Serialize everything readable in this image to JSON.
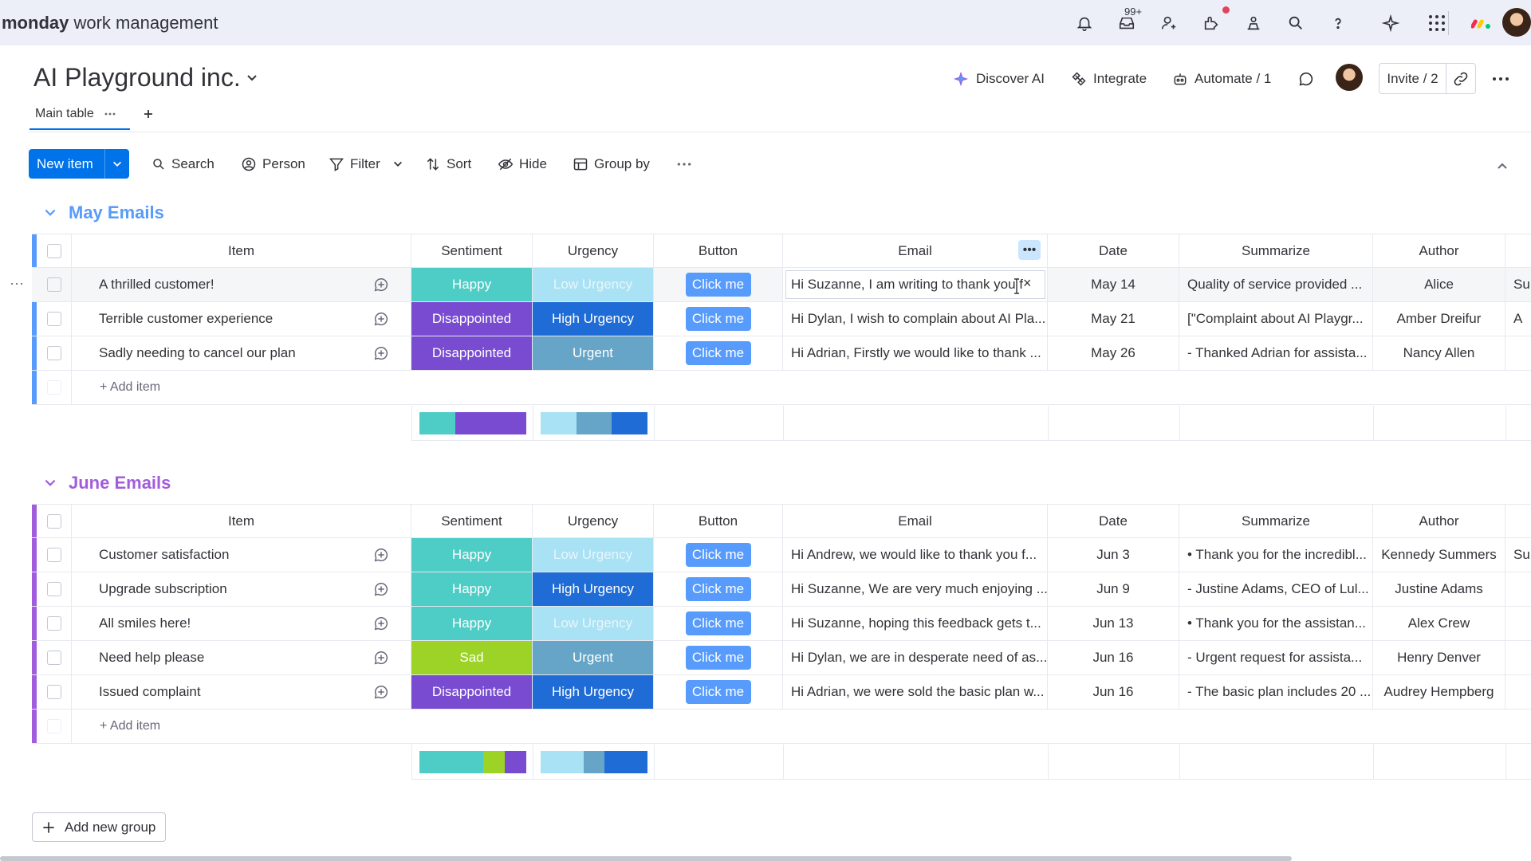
{
  "app": {
    "brand_bold": "monday",
    "brand_rest": "work management",
    "notification_badge": "99+"
  },
  "board": {
    "title": "AI Playground inc."
  },
  "header_actions": {
    "discover_ai": "Discover AI",
    "integrate": "Integrate",
    "automate": "Automate / 1",
    "invite": "Invite / 2"
  },
  "tabs": {
    "main": "Main table"
  },
  "toolbar": {
    "new_item": "New item",
    "search": "Search",
    "person": "Person",
    "filter": "Filter",
    "sort": "Sort",
    "hide": "Hide",
    "group_by": "Group by"
  },
  "columns": {
    "item": "Item",
    "sentiment": "Sentiment",
    "urgency": "Urgency",
    "button": "Button",
    "email": "Email",
    "date": "Date",
    "summarize": "Summarize",
    "author": "Author"
  },
  "colors": {
    "happy": "#4eccc6",
    "disappointed": "#784bd1",
    "sad": "#9cd326",
    "low_urgency": "#a9e2f4",
    "high_urgency": "#1f6cd6",
    "urgent": "#66a5c7",
    "button": "#579bfc",
    "may_group": "#579bfc",
    "june_group": "#a25ddc"
  },
  "groups": [
    {
      "name": "May Emails",
      "add_item": "+ Add item",
      "rows": [
        {
          "item": "A thrilled customer!",
          "sentiment": "Happy",
          "urgency": "Low Urgency",
          "button": "Click me",
          "email": "Hi Suzanne, I am writing to thank you f",
          "date": "May 14",
          "summarize": "Quality of service provided ...",
          "author": "Alice",
          "extra": "Su"
        },
        {
          "item": "Terrible customer experience",
          "sentiment": "Disappointed",
          "urgency": "High Urgency",
          "button": "Click me",
          "email": "Hi Dylan, I wish to complain about AI Pla...",
          "date": "May 21",
          "summarize": "[\"Complaint about AI Playgr...",
          "author": "Amber Dreifur",
          "extra": "A"
        },
        {
          "item": "Sadly needing to cancel our plan",
          "sentiment": "Disappointed",
          "urgency": "Urgent",
          "button": "Click me",
          "email": "Hi Adrian, Firstly we would like to thank ...",
          "date": "May 26",
          "summarize": "- Thanked Adrian for assista...",
          "author": "Nancy Allen",
          "extra": ""
        }
      ]
    },
    {
      "name": "June Emails",
      "add_item": "+ Add item",
      "rows": [
        {
          "item": "Customer satisfaction",
          "sentiment": "Happy",
          "urgency": "Low Urgency",
          "button": "Click me",
          "email": "Hi Andrew, we would like to thank you f...",
          "date": "Jun 3",
          "summarize": "• Thank you for the incredibl...",
          "author": "Kennedy Summers",
          "extra": "Su"
        },
        {
          "item": "Upgrade subscription",
          "sentiment": "Happy",
          "urgency": "High Urgency",
          "button": "Click me",
          "email": "Hi Suzanne, We are very much enjoying ...",
          "date": "Jun 9",
          "summarize": "- Justine Adams, CEO of Lul...",
          "author": "Justine Adams",
          "extra": ""
        },
        {
          "item": "All smiles here!",
          "sentiment": "Happy",
          "urgency": "Low Urgency",
          "button": "Click me",
          "email": "Hi Suzanne, hoping this feedback gets t...",
          "date": "Jun 13",
          "summarize": "• Thank you for the assistan...",
          "author": "Alex Crew",
          "extra": ""
        },
        {
          "item": "Need help please",
          "sentiment": "Sad",
          "urgency": "Urgent",
          "button": "Click me",
          "email": "Hi Dylan, we are in desperate need of as...",
          "date": "Jun 16",
          "summarize": "- Urgent request for assista...",
          "author": "Henry Denver",
          "extra": ""
        },
        {
          "item": "Issued complaint",
          "sentiment": "Disappointed",
          "urgency": "High Urgency",
          "button": "Click me",
          "email": "Hi Adrian, we were sold the basic plan w...",
          "date": "Jun 16",
          "summarize": "- The basic plan includes 20 ...",
          "author": "Audrey Hempberg",
          "extra": ""
        }
      ]
    }
  ],
  "add_group": "Add new group"
}
